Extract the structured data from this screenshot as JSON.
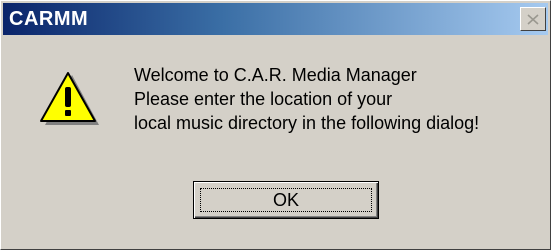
{
  "window": {
    "title": "CARMM",
    "close_icon": "close-x-icon"
  },
  "message": {
    "icon": "warning-icon",
    "lines": [
      "Welcome to C.A.R. Media Manager",
      "Please enter the location of your",
      "local music directory in the following dialog!"
    ]
  },
  "buttons": {
    "ok_label": "OK"
  },
  "colors": {
    "titlebar_start": "#0a246a",
    "titlebar_end": "#a6caf0",
    "face": "#d4d0c8",
    "warning_fill": "#ffff00"
  }
}
